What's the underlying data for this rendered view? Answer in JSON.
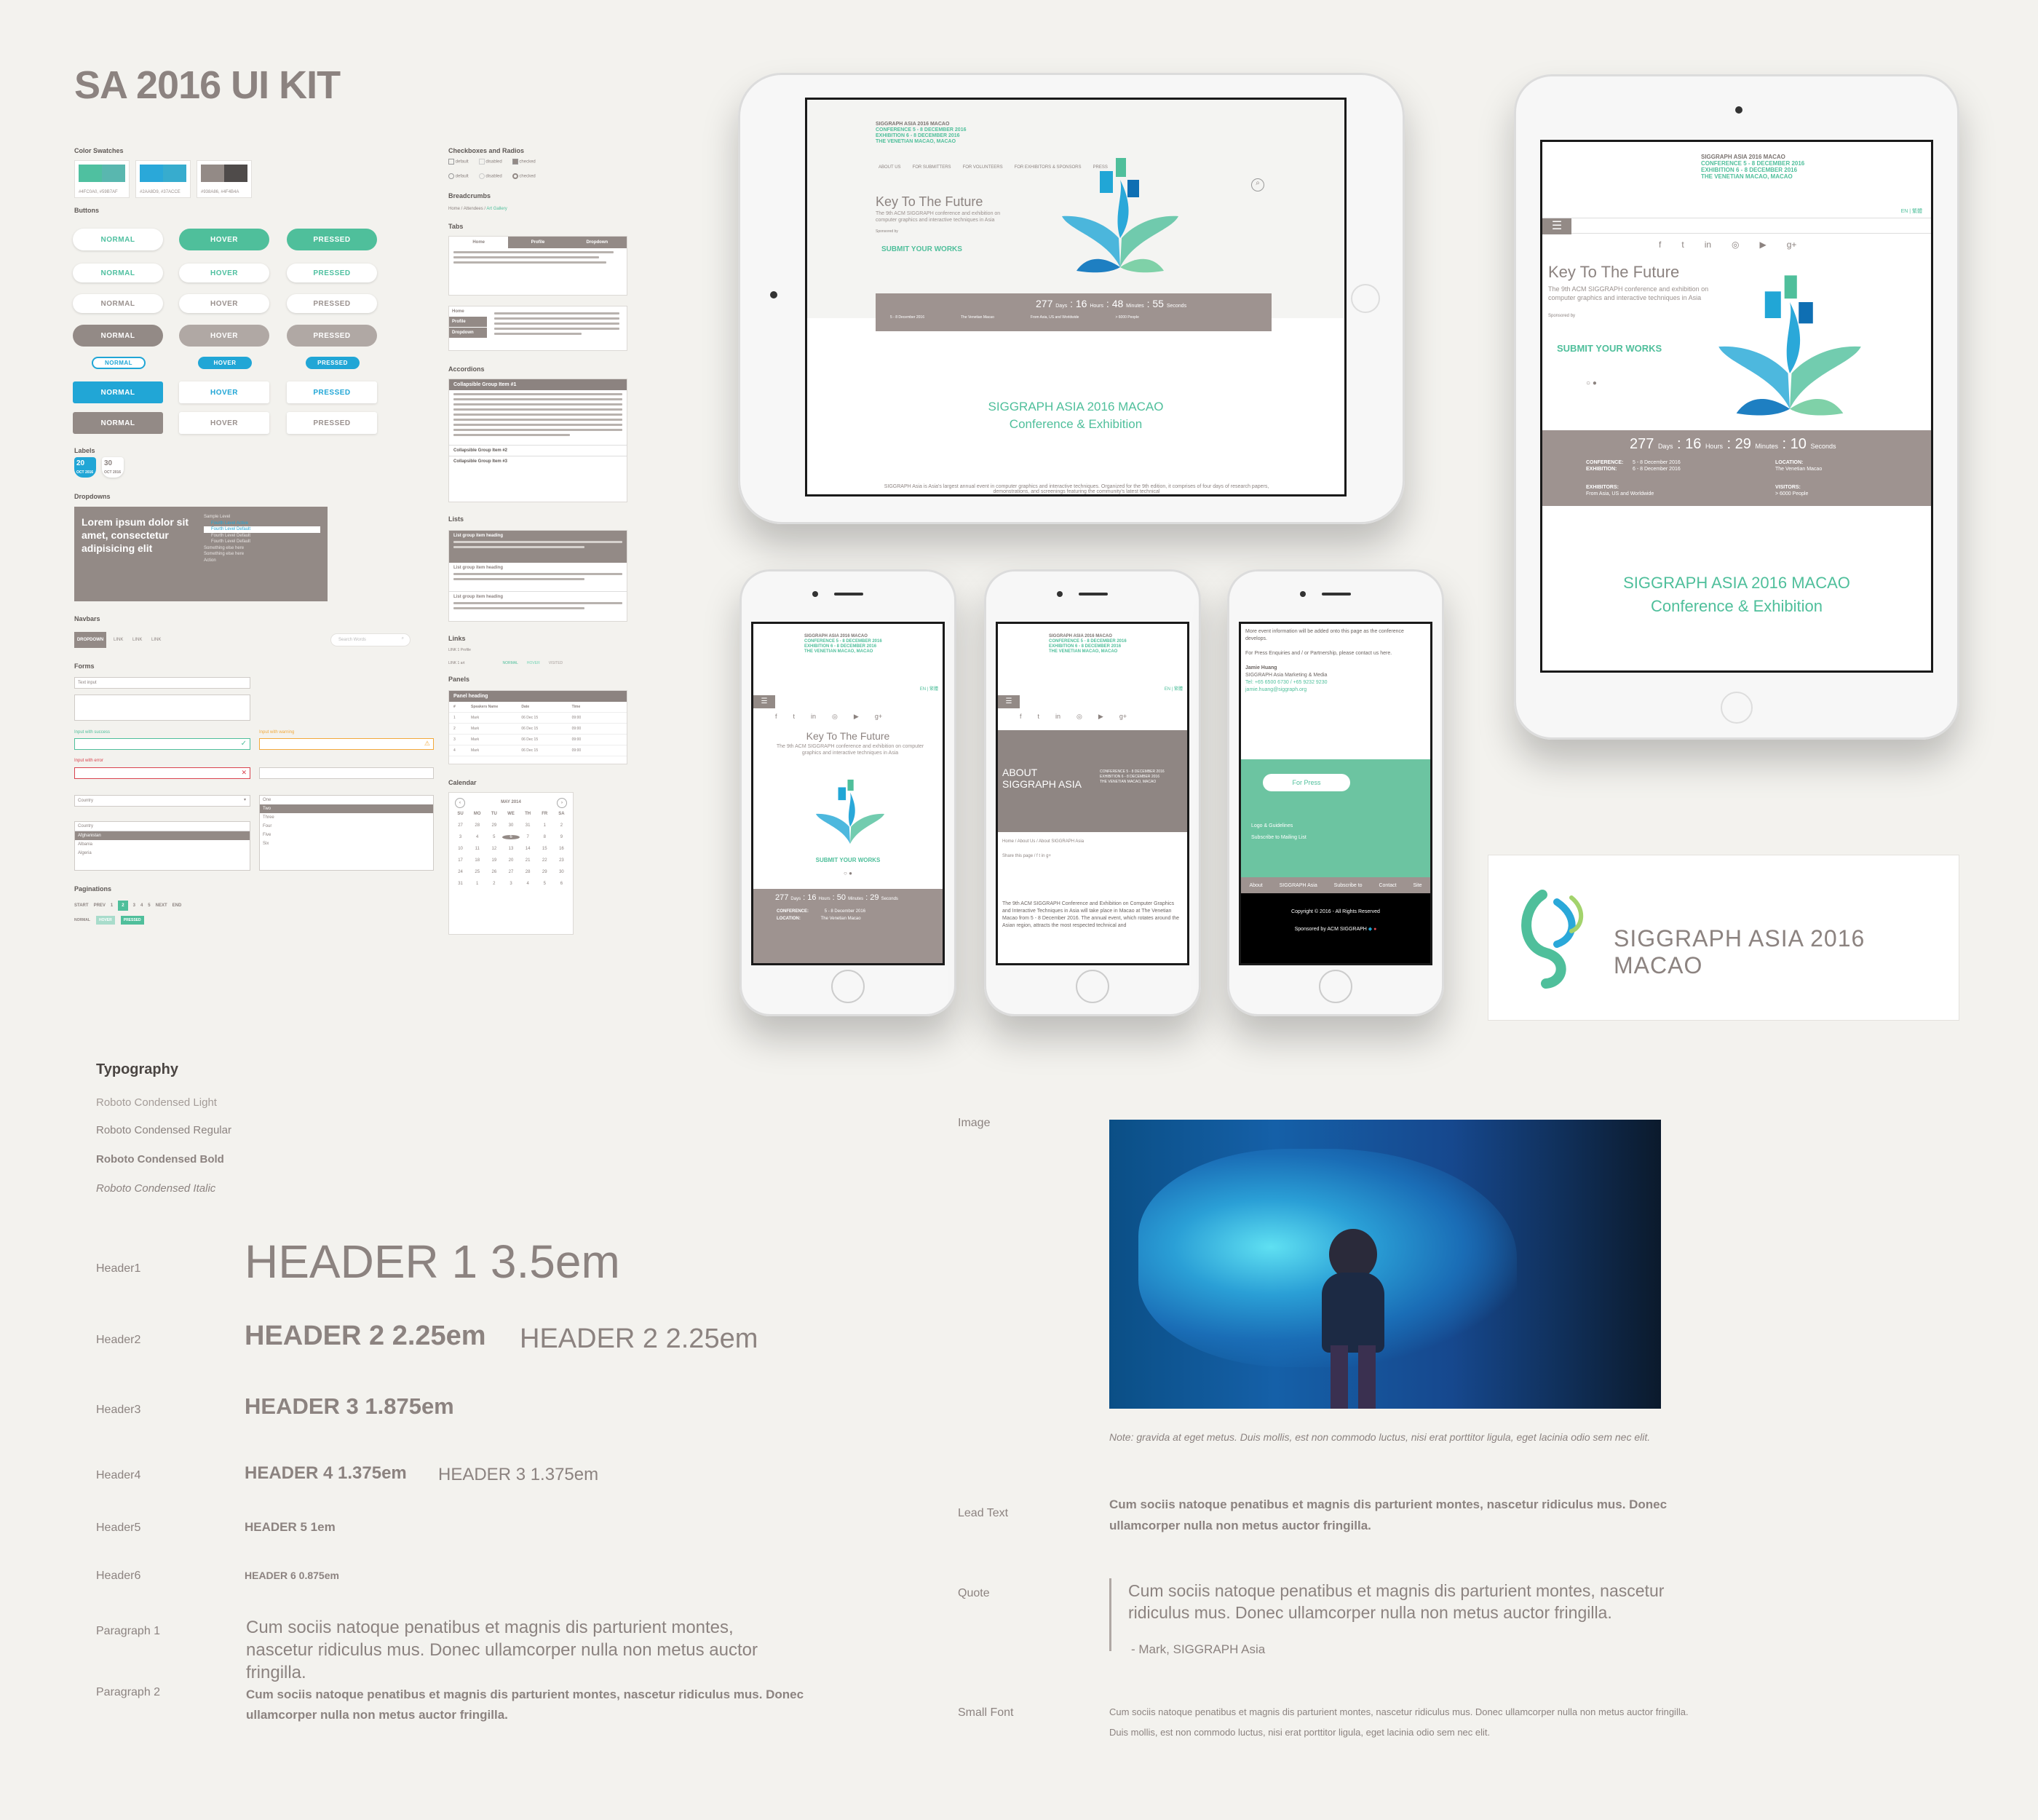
{
  "page_title": "SA 2016 UI KIT",
  "colors": {
    "teal": "#4fbf9b",
    "blue": "#21a6d6",
    "taupe": "#8c8380",
    "bg": "#f3f2ee"
  },
  "sections": {
    "color_swatches": "Color Swatches",
    "swatch_captions": [
      "#4FC0A0, #59B7AF",
      "#2AA8D9, #37ACCE",
      "#938A86, #4F4B4A"
    ],
    "buttons": "Buttons",
    "labels": "Labels",
    "dropdowns": "Dropdowns",
    "navbars": "Navbars",
    "forms": "Forms",
    "paginations": "Paginations",
    "checkboxes": "Checkboxes and Radios",
    "breadcrumbs": "Breadcrumbs",
    "tabs": "Tabs",
    "accordions": "Accordions",
    "lists": "Lists",
    "links": "Links",
    "panels": "Panels",
    "calendar": "Calendar"
  },
  "btn": {
    "normal": "NORMAL",
    "hover": "HOVER",
    "pressed": "PRESSED"
  },
  "label_badges": [
    {
      "day": "20",
      "mon": "OCT 2016"
    },
    {
      "day": "30",
      "mon": "OCT 2016"
    }
  ],
  "dropdown": {
    "text": "Lorem ipsum dolor sit amet, consectetur adipisicing elit",
    "items": [
      "Sample Level",
      "Fourth Level Active",
      "Fourth Level Default",
      "Fourth Level Default",
      "Fourth Level Default",
      "Something else here",
      "Something else here",
      "Action"
    ]
  },
  "navbar": {
    "active": "DROPDOWN",
    "links": [
      "LINK",
      "LINK",
      "LINK"
    ],
    "search": "Search Words"
  },
  "forms": {
    "text_input": "Text input",
    "success": "Input with success",
    "warning": "Input with warning",
    "error": "Input with error",
    "select": "Country",
    "options": [
      "Afghanistan",
      "Albania",
      "Algeria"
    ],
    "list": [
      "One",
      "Two",
      "Three",
      "Four",
      "Five",
      "Six"
    ]
  },
  "pagination": {
    "items": [
      "START",
      "PREV",
      "1",
      "2",
      "3",
      "4",
      "5",
      "NEXT",
      "END"
    ],
    "states": [
      "NORMAL",
      "HOVER",
      "PRESSED"
    ]
  },
  "checks": {
    "default": "default",
    "disabled": "disabled",
    "checked": "checked"
  },
  "breadcrumb": [
    "Home",
    "Attendees",
    "Art Gallery"
  ],
  "tabs": [
    "Home",
    "Profile",
    "Dropdown"
  ],
  "side_tabs": [
    "Home",
    "Profile",
    "Dropdown"
  ],
  "accordion": {
    "item1": "Collapsible Group Item #1",
    "item2": "Collapsible Group Item #2",
    "item3": "Collapsible Group Item #3"
  },
  "list_heading": "List group item heading",
  "links": {
    "link": "LINK 1 Profile",
    "states": [
      "NORMAL",
      "HOVER",
      "VISITED"
    ],
    "line2": "LINK 1 art"
  },
  "panel": {
    "heading": "Panel heading",
    "cols": [
      "#",
      "Speakers Name",
      "Date",
      "Time"
    ],
    "rows": [
      [
        "1",
        "Mark",
        "06 Dec 15",
        "09:00"
      ],
      [
        "2",
        "Mark",
        "06 Dec 15",
        "09:00"
      ],
      [
        "3",
        "Mark",
        "06 Dec 15",
        "09:00"
      ],
      [
        "4",
        "Mark",
        "06 Dec 15",
        "09:00"
      ]
    ]
  },
  "calendar": {
    "month": "MAY 2014",
    "days": [
      "SU",
      "MO",
      "TU",
      "WE",
      "TH",
      "FR",
      "SA"
    ],
    "dates": [
      "27",
      "28",
      "29",
      "30",
      "31",
      "1",
      "2",
      "3",
      "4",
      "5",
      "6",
      "7",
      "8",
      "9",
      "10",
      "11",
      "12",
      "13",
      "14",
      "15",
      "16",
      "17",
      "18",
      "19",
      "20",
      "21",
      "22",
      "23",
      "24",
      "25",
      "26",
      "27",
      "28",
      "29",
      "30",
      "31",
      "1",
      "2",
      "3",
      "4",
      "5",
      "6"
    ]
  },
  "site": {
    "brand": "SIGGRAPH ASIA 2016 MACAO",
    "conference": "CONFERENCE  5 - 8 DECEMBER 2016",
    "exhibition": "EXHIBITION  6 - 8 DECEMBER 2016",
    "venue": "THE VENETIAN MACAO, MACAO",
    "nav": [
      "ABOUT US",
      "FOR SUBMITTERS",
      "FOR VOLUNTEERS",
      "FOR EXHIBITORS & SPONSORS",
      "PRESS"
    ],
    "hero_title": "Key To The Future",
    "hero_text": "The 9th ACM SIGGRAPH conference and exhibition on computer graphics and interactive techniques in Asia",
    "sponsored": "Sponsored by",
    "cta": "SUBMIT YOUR WORKS",
    "count_tablet": {
      "days": "277",
      "hours": "16",
      "minutes": "48",
      "seconds": "55"
    },
    "count_tablet2": {
      "days": "277",
      "hours": "16",
      "minutes": "29",
      "seconds": "10"
    },
    "count_phone": {
      "days": "277",
      "hours": "16",
      "minutes": "50",
      "seconds": "29"
    },
    "unit_days": "Days",
    "unit_hours": "Hours",
    "unit_minutes": "Minutes",
    "unit_seconds": "Seconds",
    "conf_label": "CONFERENCE:",
    "exh_label": "EXHIBITION:",
    "conf_date": "5 - 8 December 2016",
    "exh_date": "6 - 8 December 2016",
    "loc_label": "LOCATION:",
    "loc_val": "The Venetian Macao",
    "exhibitors_label": "EXHIBITORS:",
    "exhibitors_val": "From Asia, US and Worldwide",
    "visitors_label": "VISITORS:",
    "visitors_val": "> 6000 People",
    "section_title_1": "SIGGRAPH ASIA 2016 MACAO",
    "section_title_2": "Conference & Exhibition",
    "about_para": "SIGGRAPH Asia is Asia's largest annual event in computer graphics and interactive techniques. Organized for the 9th edition, it comprises of four days of research papers, demonstrations, and screenings featuring the community's latest technical",
    "lang": "EN | 繁體",
    "about_title": "ABOUT SIGGRAPH ASIA",
    "crumb": "Home / About Us / About SIGGRAPH Asia",
    "share": "Share this page /",
    "about_text": "The 9th ACM SIGGRAPH Conference and Exhibition on Computer Graphics and Interactive Techniques in Asia will take place in Macao at The Venetian Macao from 5 - 8 December 2016. The annual event, which rotates around the Asian region, attracts the most respected technical and",
    "press_intro": "More event information will be added onto this page as the conference develops.",
    "press_enq": "For Press Enquiries and / or Partnership, please contact us here.",
    "contact_name": "Jamie Huang",
    "contact_role": "SIGGRAPH Asia Marketing & Media",
    "contact_tel": "Tel: +65 6500 6730 / +65 9232 9230",
    "contact_mail": "jamie.huang@siggraph.org",
    "for_press": "For Press",
    "press_links": [
      "Logo & Guidelines",
      "Subscribe to Mailing List"
    ],
    "footer_links": [
      "About",
      "SIGGRAPH Asia",
      "Subscribe to",
      "Contact",
      "Site"
    ],
    "copyright": "Copyright © 2016 - All Rights Reserved",
    "sponsored_by_acm": "Sponsored by ACM SIGGRAPH"
  },
  "logo_card": {
    "text": "SIGGRAPH ASIA 2016 MACAO"
  },
  "typography": {
    "heading": "Typography",
    "fonts": [
      "Roboto Condensed  Light",
      "Roboto Condensed  Regular",
      "Roboto Condensed  Bold",
      "Roboto Condensed  Italic"
    ],
    "rows": [
      {
        "label": "Header1",
        "sample": "HEADER 1  3.5em",
        "alt": ""
      },
      {
        "label": "Header2",
        "sample": "HEADER 2   2.25em",
        "alt": "HEADER 2 2.25em"
      },
      {
        "label": "Header3",
        "sample": "HEADER 3   1.875em",
        "alt": ""
      },
      {
        "label": "Header4",
        "sample": "HEADER 4  1.375em",
        "alt": "HEADER 3  1.375em"
      },
      {
        "label": "Header5",
        "sample": "HEADER 5  1em",
        "alt": ""
      },
      {
        "label": "Header6",
        "sample": "HEADER 6  0.875em",
        "alt": ""
      },
      {
        "label": "Paragraph 1",
        "sample": "Cum sociis natoque penatibus et magnis dis parturient montes, nascetur ridiculus mus. Donec ullamcorper nulla non metus auctor fringilla.",
        "alt": ""
      },
      {
        "label": "Paragraph 2",
        "sample": "Cum sociis natoque penatibus et magnis dis parturient montes, nascetur ridiculus mus. Donec ullamcorper nulla non metus auctor fringilla.",
        "alt": ""
      }
    ]
  },
  "content": {
    "image_label": "Image",
    "image_note": "Note: gravida at eget metus. Duis mollis, est non commodo luctus, nisi erat porttitor ligula, eget lacinia odio sem nec elit.",
    "lead_label": "Lead Text",
    "lead": "Cum sociis natoque penatibus et magnis dis parturient montes, nascetur ridiculus mus. Donec ullamcorper nulla non metus auctor fringilla.",
    "quote_label": "Quote",
    "quote": "Cum sociis natoque penatibus et magnis dis parturient montes, nascetur ridiculus mus. Donec ullamcorper nulla non metus auctor fringilla.",
    "quote_author": "- Mark, SIGGRAPH Asia",
    "small_label": "Small Font",
    "small_1": "Cum sociis natoque penatibus et magnis dis parturient montes, nascetur ridiculus mus. Donec ullamcorper nulla non metus auctor fringilla.",
    "small_2": "Duis mollis, est non commodo luctus, nisi erat porttitor ligula, eget lacinia odio sem nec elit."
  }
}
